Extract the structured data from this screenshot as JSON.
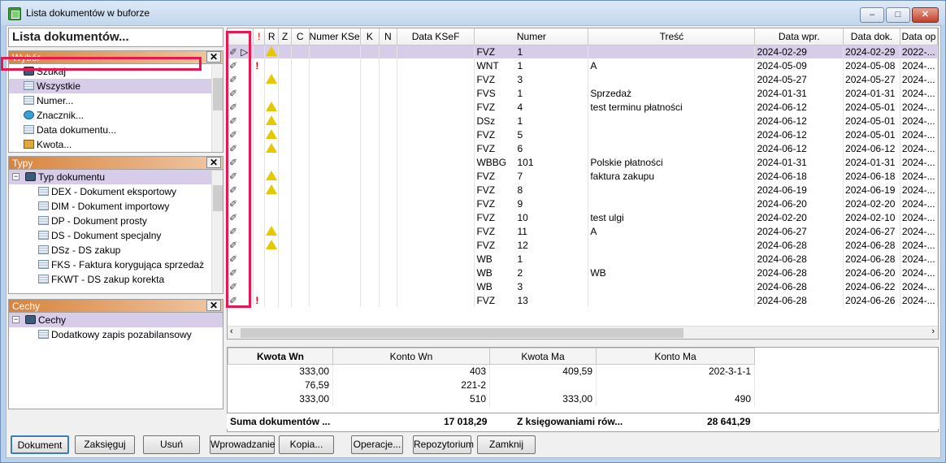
{
  "window": {
    "title": "Lista dokumentów w buforze",
    "min": "–",
    "max": "□",
    "close": "✕"
  },
  "left": {
    "heading": "Lista dokumentów...",
    "wybor": {
      "title": "Wybór",
      "close": "✕",
      "items": [
        {
          "label": "Szukaj",
          "icon": "binoculars-icon"
        },
        {
          "label": "Wszystkie",
          "icon": "list-icon"
        },
        {
          "label": "Numer...",
          "icon": "list-icon"
        },
        {
          "label": "Znacznik...",
          "icon": "marker-icon"
        },
        {
          "label": "Data dokumentu...",
          "icon": "list-icon"
        },
        {
          "label": "Kwota...",
          "icon": "coins-icon"
        }
      ]
    },
    "typy": {
      "title": "Typy",
      "close": "✕",
      "root": "Typ dokumentu",
      "items": [
        "DEX - Dokument eksportowy",
        "DIM - Dokument importowy",
        "DP - Dokument prosty",
        "DS - Dokument specjalny",
        "DSz - DS zakup",
        "FKS - Faktura korygująca sprzedaż",
        "FKWT - DS zakup korekta"
      ]
    },
    "cechy": {
      "title": "Cechy",
      "close": "✕",
      "root": "Cechy",
      "items": [
        "Dodatkowy zapis pozabilansowy"
      ]
    }
  },
  "grid": {
    "headers": [
      "",
      "!",
      "R",
      "Z",
      "C",
      "Numer KSe",
      "K",
      "N",
      "Data KSeF",
      "Numer",
      "Treść",
      "Data wpr.",
      "Data dok.",
      "Data op"
    ],
    "rows": [
      {
        "warn": true,
        "excl": false,
        "typ": "FVZ",
        "nr": "1",
        "tresc": "",
        "dwpr": "2024-02-29",
        "ddok": "2024-02-29",
        "dop": "2022-..."
      },
      {
        "warn": false,
        "excl": true,
        "typ": "WNT",
        "nr": "1",
        "tresc": "A",
        "dwpr": "2024-05-09",
        "ddok": "2024-05-08",
        "dop": "2024-..."
      },
      {
        "warn": true,
        "excl": false,
        "typ": "FVZ",
        "nr": "3",
        "tresc": "",
        "dwpr": "2024-05-27",
        "ddok": "2024-05-27",
        "dop": "2024-..."
      },
      {
        "warn": false,
        "excl": false,
        "typ": "FVS",
        "nr": "1",
        "tresc": "Sprzedaż",
        "dwpr": "2024-01-31",
        "ddok": "2024-01-31",
        "dop": "2024-..."
      },
      {
        "warn": true,
        "excl": false,
        "typ": "FVZ",
        "nr": "4",
        "tresc": "test terminu płatności",
        "dwpr": "2024-06-12",
        "ddok": "2024-05-01",
        "dop": "2024-..."
      },
      {
        "warn": true,
        "excl": false,
        "typ": "DSz",
        "nr": "1",
        "tresc": "",
        "dwpr": "2024-06-12",
        "ddok": "2024-05-01",
        "dop": "2024-..."
      },
      {
        "warn": true,
        "excl": false,
        "typ": "FVZ",
        "nr": "5",
        "tresc": "",
        "dwpr": "2024-06-12",
        "ddok": "2024-05-01",
        "dop": "2024-..."
      },
      {
        "warn": true,
        "excl": false,
        "typ": "FVZ",
        "nr": "6",
        "tresc": "",
        "dwpr": "2024-06-12",
        "ddok": "2024-06-12",
        "dop": "2024-..."
      },
      {
        "warn": false,
        "excl": false,
        "typ": "WBBG",
        "nr": "101",
        "tresc": "Polskie płatności",
        "dwpr": "2024-01-31",
        "ddok": "2024-01-31",
        "dop": "2024-..."
      },
      {
        "warn": true,
        "excl": false,
        "typ": "FVZ",
        "nr": "7",
        "tresc": "faktura zakupu",
        "dwpr": "2024-06-18",
        "ddok": "2024-06-18",
        "dop": "2024-..."
      },
      {
        "warn": true,
        "excl": false,
        "typ": "FVZ",
        "nr": "8",
        "tresc": "",
        "dwpr": "2024-06-19",
        "ddok": "2024-06-19",
        "dop": "2024-..."
      },
      {
        "warn": false,
        "excl": false,
        "typ": "FVZ",
        "nr": "9",
        "tresc": "",
        "dwpr": "2024-06-20",
        "ddok": "2024-02-20",
        "dop": "2024-..."
      },
      {
        "warn": false,
        "excl": false,
        "typ": "FVZ",
        "nr": "10",
        "tresc": "test ulgi",
        "dwpr": "2024-02-20",
        "ddok": "2024-02-10",
        "dop": "2024-..."
      },
      {
        "warn": true,
        "excl": false,
        "typ": "FVZ",
        "nr": "11",
        "tresc": "A",
        "dwpr": "2024-06-27",
        "ddok": "2024-06-27",
        "dop": "2024-..."
      },
      {
        "warn": true,
        "excl": false,
        "typ": "FVZ",
        "nr": "12",
        "tresc": "",
        "dwpr": "2024-06-28",
        "ddok": "2024-06-28",
        "dop": "2024-..."
      },
      {
        "warn": false,
        "excl": false,
        "typ": "WB",
        "nr": "1",
        "tresc": "",
        "dwpr": "2024-06-28",
        "ddok": "2024-06-28",
        "dop": "2024-..."
      },
      {
        "warn": false,
        "excl": false,
        "typ": "WB",
        "nr": "2",
        "tresc": "WB",
        "dwpr": "2024-06-28",
        "ddok": "2024-06-20",
        "dop": "2024-..."
      },
      {
        "warn": false,
        "excl": false,
        "typ": "WB",
        "nr": "3",
        "tresc": "",
        "dwpr": "2024-06-28",
        "ddok": "2024-06-22",
        "dop": "2024-..."
      },
      {
        "warn": false,
        "excl": true,
        "typ": "FVZ",
        "nr": "13",
        "tresc": "",
        "dwpr": "2024-06-28",
        "ddok": "2024-06-26",
        "dop": "2024-..."
      }
    ]
  },
  "bottom": {
    "headers": [
      "Kwota Wn",
      "Konto Wn",
      "Kwota Ma",
      "Konto Ma"
    ],
    "rows": [
      [
        "333,00",
        "403",
        "409,59",
        "202-3-1-1"
      ],
      [
        "76,59",
        "221-2",
        "",
        ""
      ],
      [
        "333,00",
        "510",
        "333,00",
        "490"
      ]
    ]
  },
  "summary": {
    "label1": "Suma dokumentów ...",
    "value1": "17 018,29",
    "label2": "Z księgowaniami rów...",
    "value2": "28 641,29"
  },
  "buttons": [
    "Dokument",
    "Zaksięguj",
    "Usuń",
    "Wprowadzanie",
    "Kopia...",
    "Operacje...",
    "Repozytorium",
    "Zamknij"
  ]
}
